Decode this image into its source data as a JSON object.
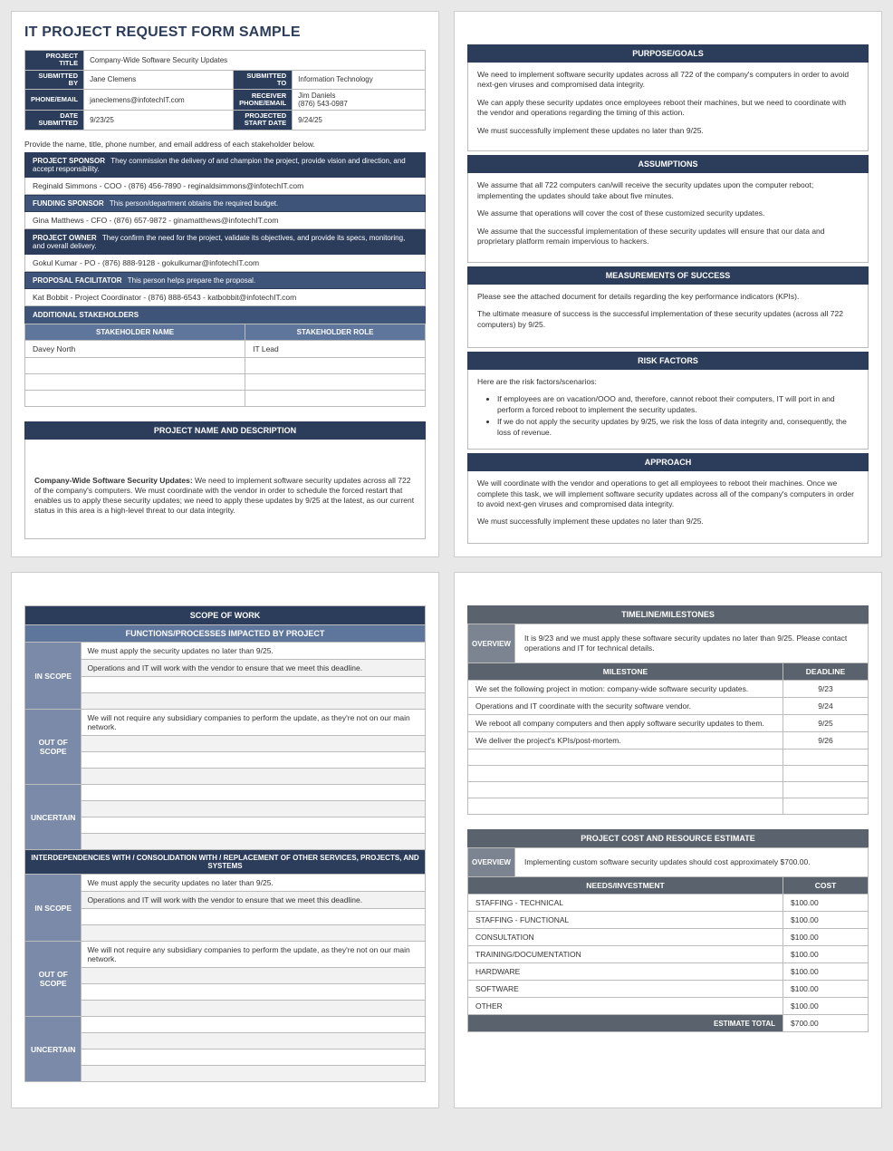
{
  "formTitle": "IT PROJECT REQUEST FORM SAMPLE",
  "meta": {
    "projectTitle_lab": "PROJECT TITLE",
    "projectTitle": "Company-Wide Software Security Updates",
    "submittedBy_lab": "SUBMITTED BY",
    "submittedBy": "Jane Clemens",
    "submittedTo_lab": "SUBMITTED TO",
    "submittedTo": "Information Technology",
    "phoneEmail_lab": "PHONE/EMAIL",
    "phoneEmail": "janeclemens@infotechIT.com",
    "receiver_lab": "RECEIVER PHONE/EMAIL",
    "receiver": "Jim Daniels\n(876) 543-0987",
    "dateSubmitted_lab": "DATE SUBMITTED",
    "dateSubmitted": "9/23/25",
    "projectedStart_lab": "PROJECTED START  DATE",
    "projectedStart": "9/24/25"
  },
  "stakeholderInstr": "Provide the name, title, phone number, and email address of each stakeholder below.",
  "stakeholders": {
    "sponsor": {
      "title": "PROJECT SPONSOR",
      "desc": "They commission the delivery of and champion the project, provide vision and direction, and accept responsibility.",
      "val": "Reginald Simmons - COO - (876) 456-7890 - reginaldsimmons@infotechIT.com"
    },
    "funding": {
      "title": "FUNDING SPONSOR",
      "desc": "This person/department obtains the required budget.",
      "val": "Gina Matthews - CFO - (876) 657-9872 - ginamatthews@infotechIT.com"
    },
    "owner": {
      "title": "PROJECT OWNER",
      "desc": "They confirm the need for the project, validate its objectives, and provide its specs, monitoring, and overall delivery.",
      "val": "Gokul Kumar - PO - (876) 888-9128 - gokulkumar@infotechIT.com"
    },
    "facilitator": {
      "title": "PROPOSAL FACILITATOR",
      "desc": "This person helps prepare the proposal.",
      "val": "Kat Bobbit - Project Coordinator - (876) 888-6543 - katbobbit@infotechIT.com"
    }
  },
  "addlHead": "ADDITIONAL STAKEHOLDERS",
  "addlCols": {
    "name": "STAKEHOLDER NAME",
    "role": "STAKEHOLDER ROLE"
  },
  "addlRows": [
    {
      "name": "Davey North",
      "role": "IT Lead"
    },
    {
      "name": "",
      "role": ""
    },
    {
      "name": "",
      "role": ""
    },
    {
      "name": "",
      "role": ""
    }
  ],
  "projDescHead": "PROJECT NAME AND DESCRIPTION",
  "projDescBold": "Company-Wide Software Security Updates:",
  "projDescBody": " We need to implement software security updates across all 722 of the company's computers. We must coordinate with the vendor in order to schedule the forced restart that enables us to apply these security updates; we need to apply these updates by 9/25 at the latest, as our current status in this area is a high-level threat to our data integrity.",
  "purpose": {
    "head": "PURPOSE/GOALS",
    "paras": [
      "We need to implement software security updates across all 722 of the company's computers in order to avoid next-gen viruses and compromised data integrity.",
      "We can apply these security updates once employees reboot their machines, but we need to coordinate with the vendor and operations regarding the timing of this action.",
      "We must successfully implement these updates no later than 9/25."
    ]
  },
  "assumptions": {
    "head": "ASSUMPTIONS",
    "paras": [
      "We assume that all 722 computers can/will receive the security updates upon the computer reboot; implementing the updates should take about five minutes.",
      "We assume that operations will cover the cost of these customized security updates.",
      "We assume that the successful implementation of these security updates will ensure that our data and proprietary platform remain impervious to hackers."
    ]
  },
  "measures": {
    "head": "MEASUREMENTS OF SUCCESS",
    "paras": [
      "Please see the attached document for details regarding the key performance indicators (KPIs).",
      "The ultimate measure of success is the successful implementation of these security updates (across all 722 computers) by 9/25."
    ]
  },
  "risk": {
    "head": "RISK FACTORS",
    "intro": "Here are the risk factors/scenarios:",
    "bullets": [
      "If employees are on vacation/OOO and, therefore, cannot reboot their computers, IT will port in and perform a forced reboot to implement the security updates.",
      "If we do not apply the security updates by 9/25, we risk the loss of data integrity and, consequently, the loss of revenue."
    ]
  },
  "approach": {
    "head": "APPROACH",
    "paras": [
      "We will coordinate with the vendor and operations to get all employees to reboot their machines. Once we complete this task, we will implement software security updates across all of the company's computers in order to avoid next-gen viruses and compromised data integrity.",
      "We must successfully implement these updates no later than 9/25."
    ]
  },
  "scope": {
    "head": "SCOPE OF WORK",
    "subhead": "FUNCTIONS/PROCESSES IMPACTED BY PROJECT",
    "interHead": "INTERDEPENDENCIES WITH / CONSOLIDATION WITH / REPLACEMENT OF OTHER SERVICES, PROJECTS, AND SYSTEMS",
    "labels": {
      "in": "IN SCOPE",
      "out": "OUT OF SCOPE",
      "unc": "UNCERTAIN"
    },
    "inScope": [
      "We must apply the security updates no later than 9/25.",
      "Operations and IT will work with the vendor to ensure that we meet this deadline.",
      "",
      ""
    ],
    "outScope": [
      "We will not require any subsidiary companies to perform the update, as they're not on our main network.",
      "",
      "",
      ""
    ],
    "uncertain": [
      "",
      "",
      "",
      ""
    ],
    "interIn": [
      "We must apply the security updates no later than 9/25.",
      "Operations and IT will work with the vendor to ensure that we meet this deadline.",
      "",
      ""
    ],
    "interOut": [
      "We will not require any subsidiary companies to perform the update, as they're not on our main network.",
      "",
      "",
      ""
    ],
    "interUnc": [
      "",
      "",
      "",
      ""
    ]
  },
  "timeline": {
    "head": "TIMELINE/MILESTONES",
    "overviewLab": "OVERVIEW",
    "overview": "It is 9/23 and we must apply these software security updates no later than 9/25. Please contact operations and IT for technical details.",
    "cols": {
      "m": "MILESTONE",
      "d": "DEADLINE"
    },
    "rows": [
      {
        "m": "We set the following project in motion: company-wide software security updates.",
        "d": "9/23"
      },
      {
        "m": "Operations and IT coordinate with the security software vendor.",
        "d": "9/24"
      },
      {
        "m": "We reboot all company computers and then apply software security updates to them.",
        "d": "9/25"
      },
      {
        "m": "We deliver the project's KPIs/post-mortem.",
        "d": "9/26"
      },
      {
        "m": "",
        "d": ""
      },
      {
        "m": "",
        "d": ""
      },
      {
        "m": "",
        "d": ""
      },
      {
        "m": "",
        "d": ""
      }
    ]
  },
  "cost": {
    "head": "PROJECT COST AND RESOURCE ESTIMATE",
    "overviewLab": "OVERVIEW",
    "overview": "Implementing custom software security updates should cost approximately $700.00.",
    "cols": {
      "n": "NEEDS/INVESTMENT",
      "c": "COST"
    },
    "rows": [
      {
        "n": "STAFFING - TECHNICAL",
        "c": "$100.00"
      },
      {
        "n": "STAFFING - FUNCTIONAL",
        "c": "$100.00"
      },
      {
        "n": "CONSULTATION",
        "c": "$100.00"
      },
      {
        "n": "TRAINING/DOCUMENTATION",
        "c": "$100.00"
      },
      {
        "n": "HARDWARE",
        "c": "$100.00"
      },
      {
        "n": "SOFTWARE",
        "c": "$100.00"
      },
      {
        "n": "OTHER",
        "c": "$100.00"
      }
    ],
    "totalLab": "ESTIMATE TOTAL",
    "total": "$700.00"
  }
}
